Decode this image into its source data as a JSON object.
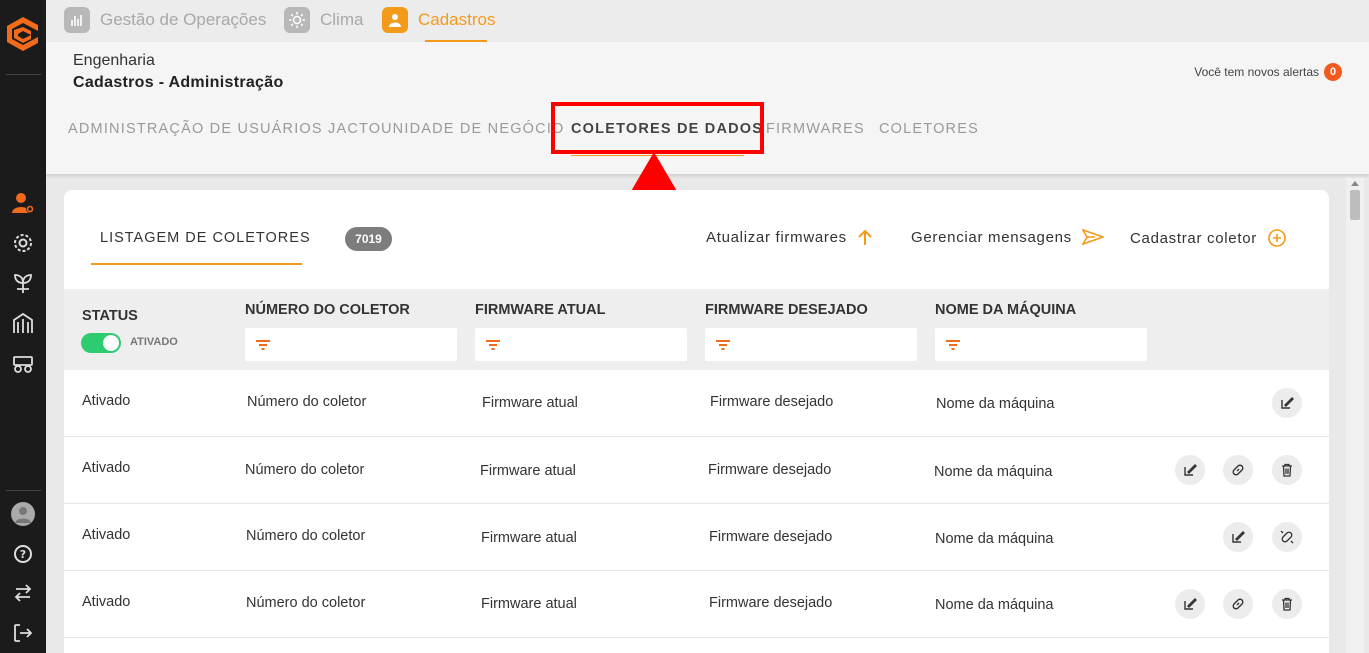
{
  "topnav": {
    "items": [
      {
        "label": "Gestão de Operações",
        "icon": "chart-icon"
      },
      {
        "label": "Clima",
        "icon": "sun-icon"
      },
      {
        "label": "Cadastros",
        "icon": "user-icon",
        "active": true
      }
    ]
  },
  "header": {
    "breadcrumb_top": "Engenharia",
    "breadcrumb_title": "Cadastros - Administração",
    "alerts_label": "Você tem novos alertas",
    "alerts_count": "0"
  },
  "subtabs": [
    {
      "label": "ADMINISTRAÇÃO DE USUÁRIOS JACTO"
    },
    {
      "label": "UNIDADE DE NEGÓCIO"
    },
    {
      "label": "COLETORES DE DADOS",
      "active": true
    },
    {
      "label": "FIRMWARES"
    },
    {
      "label": "COLETORES"
    }
  ],
  "listing": {
    "title": "LISTAGEM DE COLETORES",
    "count": "7019",
    "actions": {
      "update_firmwares": "Atualizar firmwares",
      "manage_messages": "Gerenciar mensagens",
      "register_collector": "Cadastrar coletor"
    }
  },
  "table": {
    "headers": {
      "status": "STATUS",
      "toggle_label": "ATIVADO",
      "number": "NÚMERO DO COLETOR",
      "current_fw": "FIRMWARE ATUAL",
      "desired_fw": "FIRMWARE DESEJADO",
      "machine": "NOME DA MÁQUINA"
    },
    "rows": [
      {
        "status": "Ativado",
        "number": "Número do coletor",
        "current_fw": "Firmware atual",
        "desired_fw": "Firmware desejado",
        "machine": "Nome da máquina"
      },
      {
        "status": "Ativado",
        "number": "Número do coletor",
        "current_fw": "Firmware atual",
        "desired_fw": "Firmware desejado",
        "machine": "Nome da máquina"
      },
      {
        "status": "Ativado",
        "number": "Número do coletor",
        "current_fw": "Firmware atual",
        "desired_fw": "Firmware desejado",
        "machine": "Nome da máquina"
      },
      {
        "status": "Ativado",
        "number": "Número do coletor",
        "current_fw": "Firmware atual",
        "desired_fw": "Firmware desejado",
        "machine": "Nome da máquina"
      }
    ]
  },
  "colors": {
    "accent": "#f39a1b",
    "highlight": "#ff0000",
    "toggle_on": "#2ecc71",
    "sidebar": "#1b1b1b"
  }
}
